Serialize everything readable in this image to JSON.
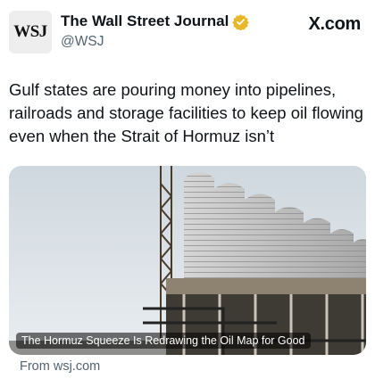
{
  "author": {
    "avatar_text": "WSJ",
    "name": "The Wall Street Journal",
    "handle": "@WSJ",
    "verified_icon": "gold-verified-badge",
    "verified_color": "#e8b829"
  },
  "site_label": "X.com",
  "tweet": {
    "text": "Gulf states are pouring money into pipelines, railroads and storage facilities to keep oil flowing even when the Strait of Hormuz isn’t"
  },
  "card": {
    "image_icon": "industrial-silos-photo",
    "caption": "The Hormuz Squeeze Is Redrawing the Oil Map for Good",
    "source": "From wsj.com"
  }
}
